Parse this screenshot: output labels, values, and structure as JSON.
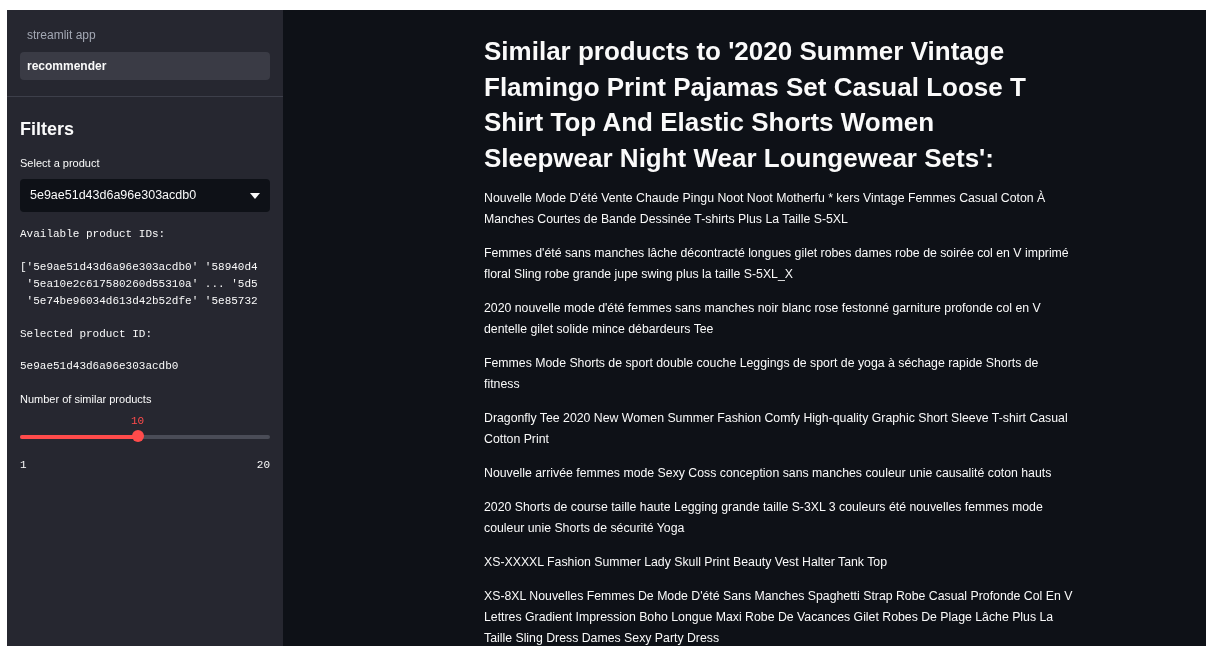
{
  "sidebar": {
    "app_name": "streamlit app",
    "nav_items": [
      {
        "label": "recommender",
        "selected": true
      }
    ],
    "header": "Filters",
    "product_select": {
      "label": "Select a product",
      "value": "5e9ae51d43d6a96e303acdb0"
    },
    "available_label": "Available product IDs:",
    "available_ids": [
      "['5e9ae51d43d6a96e303acdb0' '58940d4",
      " '5ea10e2c617580260d55310a' ... '5d5",
      " '5e74be96034d613d42b52dfe' '5e85732"
    ],
    "selected_label": "Selected product ID:",
    "selected_value": "5e9ae51d43d6a96e303acdb0",
    "slider": {
      "label": "Number of similar products",
      "value": "10",
      "level": 0.47,
      "min": "1",
      "max": "20"
    }
  },
  "main": {
    "title": "Similar products to '2020 Summer Vintage Flamingo Print Pajamas Set Casual Loose T Shirt Top And Elastic Shorts Women Sleepwear Night Wear Loungewear Sets':",
    "products": [
      "Nouvelle Mode D'été Vente Chaude Pingu Noot Noot Motherfu * kers Vintage Femmes Casual Coton À Manches Courtes de Bande Dessinée T-shirts Plus La Taille S-5XL",
      "Femmes d'été sans manches lâche décontracté longues gilet robes dames robe de soirée col en V imprimé floral Sling robe grande jupe swing plus la taille S-5XL_X",
      "2020 nouvelle mode d'été femmes sans manches noir blanc rose festonné garniture profonde col en V dentelle gilet solide mince débardeurs Tee",
      "Femmes Mode Shorts de sport double couche Leggings de sport de yoga à séchage rapide Shorts de fitness",
      "Dragonfly Tee 2020 New Women Summer Fashion Comfy High-quality Graphic Short Sleeve T-shirt Casual Cotton Print",
      "Nouvelle arrivée femmes mode Sexy Coss conception sans manches couleur unie causalité coton hauts",
      "2020 Shorts de course taille haute Legging grande taille S-3XL 3 couleurs été nouvelles femmes mode couleur unie Shorts de sécurité Yoga",
      "XS-XXXXL Fashion Summer Lady Skull Print Beauty Vest Halter Tank Top",
      "XS-8XL Nouvelles Femmes De Mode D'été Sans Manches Spaghetti Strap Robe Casual Profonde Col En V Lettres Gradient Impression Boho Longue Maxi Robe De Vacances Gilet Robes De Plage Lâche Plus La Taille Sling Dress Dames Sexy Party Dress"
    ]
  }
}
